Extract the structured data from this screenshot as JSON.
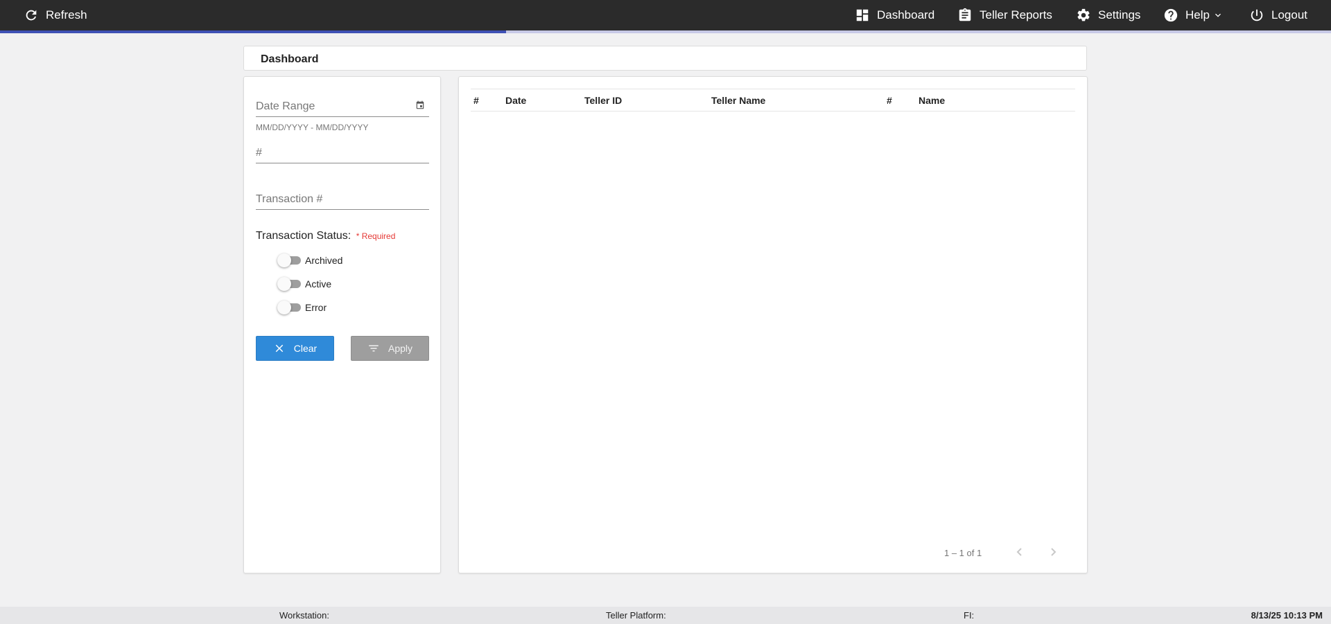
{
  "topbar": {
    "refresh_label": "Refresh",
    "nav": {
      "dashboard": "Dashboard",
      "teller_reports": "Teller Reports",
      "settings": "Settings",
      "help": "Help",
      "logout": "Logout"
    },
    "load_progress": 0.38
  },
  "header": {
    "title": "Dashboard"
  },
  "filters": {
    "date_range": {
      "placeholder": "Date Range",
      "hint": "MM/DD/YYYY - MM/DD/YYYY"
    },
    "number": {
      "placeholder": "#"
    },
    "transaction_number": {
      "placeholder": "Transaction #"
    },
    "status": {
      "label": "Transaction Status:",
      "required": "* Required",
      "options": [
        {
          "label": "Archived",
          "checked": false
        },
        {
          "label": "Active",
          "checked": false
        },
        {
          "label": "Error",
          "checked": false
        }
      ]
    },
    "clear_label": "Clear",
    "apply_label": "Apply"
  },
  "table": {
    "columns": [
      "#",
      "Date",
      "Teller ID",
      "Teller Name",
      "#",
      "Name"
    ],
    "rows": [],
    "pagination": {
      "range": "1 – 1 of 1"
    }
  },
  "footer": {
    "workstation": "Workstation:",
    "teller_platform": "Teller Platform:",
    "fi": "FI:",
    "datetime": "8/13/25 10:13 PM"
  },
  "colors": {
    "topbar": "#2b2b2b",
    "progress": "#3f51b5",
    "clear_button": "#2f8ad9",
    "apply_button": "#9e9e9e",
    "required": "#e53935"
  }
}
